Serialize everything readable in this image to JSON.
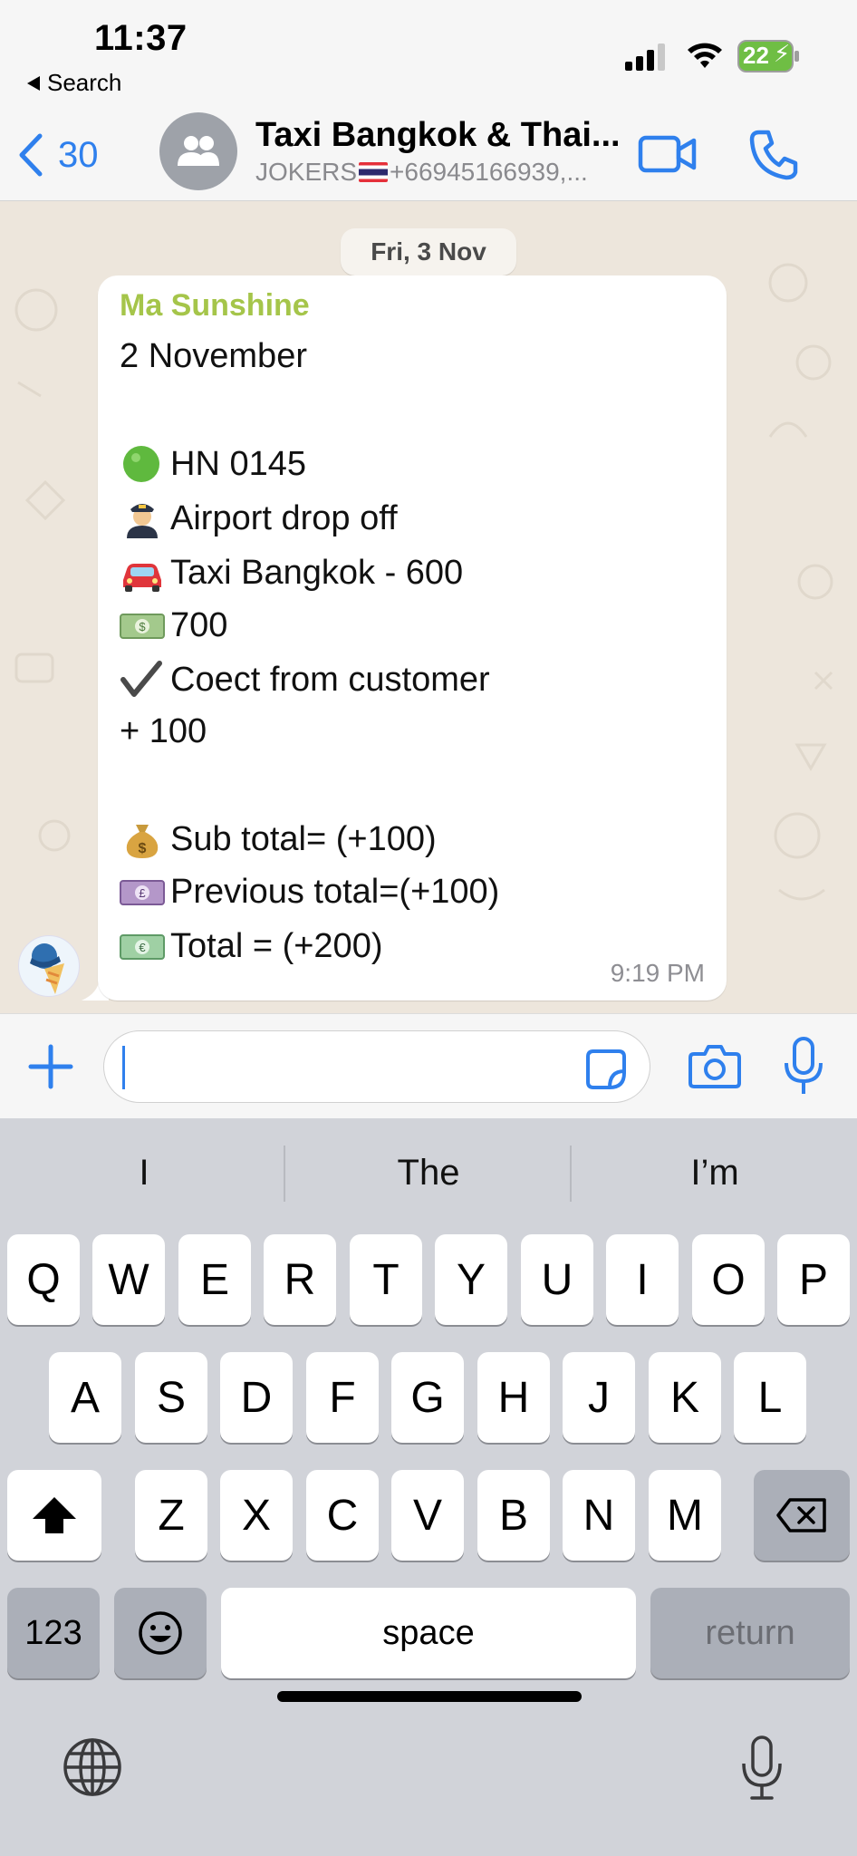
{
  "status_bar": {
    "time": "11:37",
    "back_app_label": "Search",
    "battery": "22"
  },
  "header": {
    "back_count": "30",
    "title": "Taxi Bangkok & Thai...",
    "subtitle_before_flag": "JOKERS",
    "subtitle_after_flag": "+66945166939,...",
    "icons": [
      "chevron-left-icon",
      "group-avatar-icon",
      "video-call-icon",
      "phone-icon"
    ],
    "accent_color": "#2f80ed"
  },
  "chat": {
    "date_label": "Fri, 3 Nov",
    "message": {
      "sender": "Ma Sunshine",
      "sender_color": "#a5c54a",
      "lines": [
        {
          "icon": "",
          "text": "2 November"
        },
        {
          "icon": "green-circle-icon",
          "text": "HN 0145"
        },
        {
          "icon": "pilot-icon",
          "text": "Airport drop off"
        },
        {
          "icon": "car-icon",
          "text": "Taxi Bangkok - 600"
        },
        {
          "icon": "dollar-bill-icon",
          "text": "700"
        },
        {
          "icon": "check-mark-icon",
          "text": "Coect from customer"
        },
        {
          "icon": "",
          "text": "+ 100"
        },
        {
          "icon": "money-bag-icon",
          "text": "Sub total= (+100)"
        },
        {
          "icon": "pound-note-icon",
          "text": "Previous total=(+100)"
        },
        {
          "icon": "euro-note-icon",
          "text": "Total = (+200)"
        }
      ],
      "time": "9:19 PM"
    }
  },
  "composer": {
    "value": "",
    "icons": [
      "plus-icon",
      "sticker-icon",
      "camera-icon",
      "microphone-icon"
    ]
  },
  "keyboard": {
    "suggestions": [
      "I",
      "The",
      "I’m"
    ],
    "row1": [
      "Q",
      "W",
      "E",
      "R",
      "T",
      "Y",
      "U",
      "I",
      "O",
      "P"
    ],
    "row2": [
      "A",
      "S",
      "D",
      "F",
      "G",
      "H",
      "J",
      "K",
      "L"
    ],
    "row3": [
      "Z",
      "X",
      "C",
      "V",
      "B",
      "N",
      "M"
    ],
    "numbers_label": "123",
    "space_label": "space",
    "return_label": "return",
    "icons": [
      "shift-icon",
      "backspace-icon",
      "emoji-icon",
      "globe-icon",
      "dictation-mic-icon"
    ]
  }
}
